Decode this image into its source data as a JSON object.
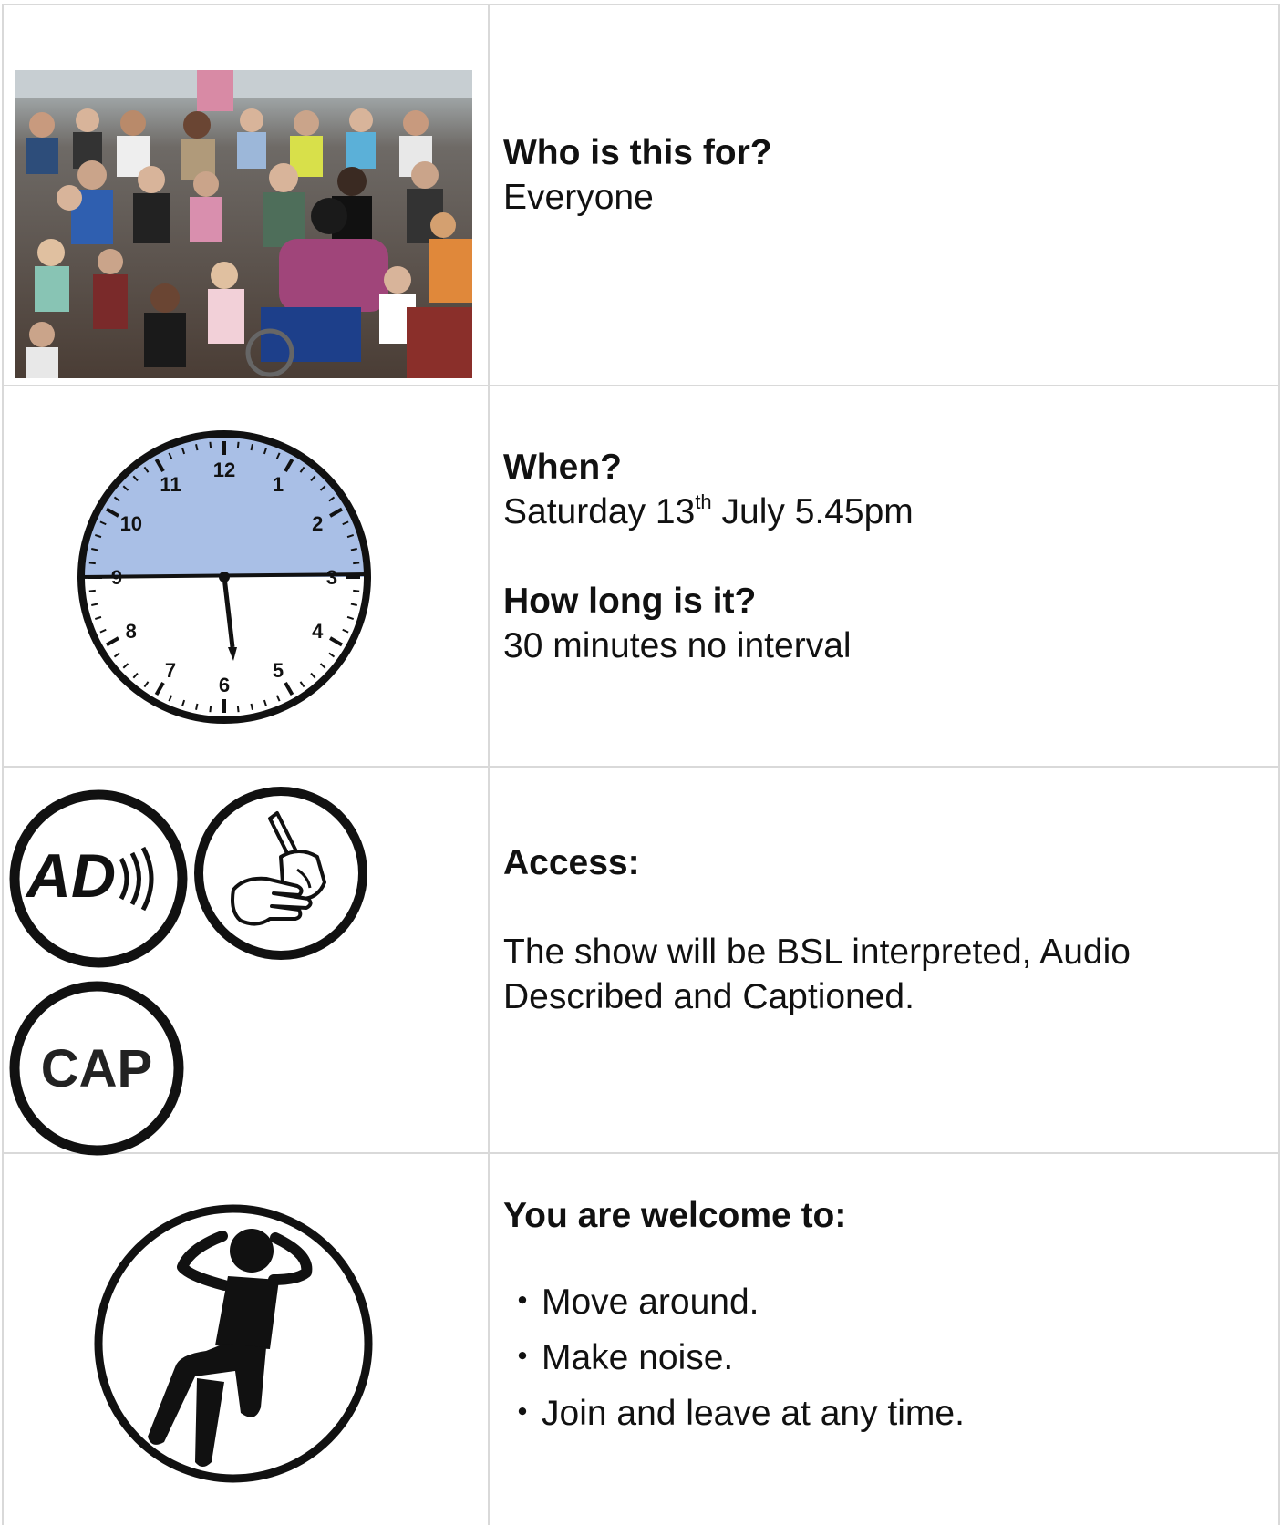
{
  "rows": [
    {
      "heading": "Who is this for?",
      "text": "Everyone"
    },
    {
      "heading": "When?",
      "date_pre": "Saturday 13",
      "date_sup": "th",
      "date_post": " July 5.45pm",
      "heading2": "How long is it?",
      "text2": "30 minutes no interval"
    },
    {
      "heading": "Access:",
      "text": "The show will be BSL interpreted, Audio Described and Captioned.",
      "icons": {
        "ad_label": "AD",
        "cap_label": "CAP"
      }
    },
    {
      "heading": "You are welcome to:",
      "bullet": "・",
      "items": [
        "Move around.",
        "Make noise.",
        "Join and leave at any time."
      ]
    }
  ],
  "clock": {
    "numbers": [
      "12",
      "1",
      "2",
      "3",
      "4",
      "5",
      "6",
      "7",
      "8",
      "9",
      "10",
      "11"
    ],
    "face_fill": "#a9bfe6",
    "time": "5.45"
  },
  "icons": [
    "crowd-photo",
    "clock-icon",
    "audio-description-icon",
    "sign-language-icon",
    "captioned-icon",
    "relaxed-person-icon"
  ]
}
